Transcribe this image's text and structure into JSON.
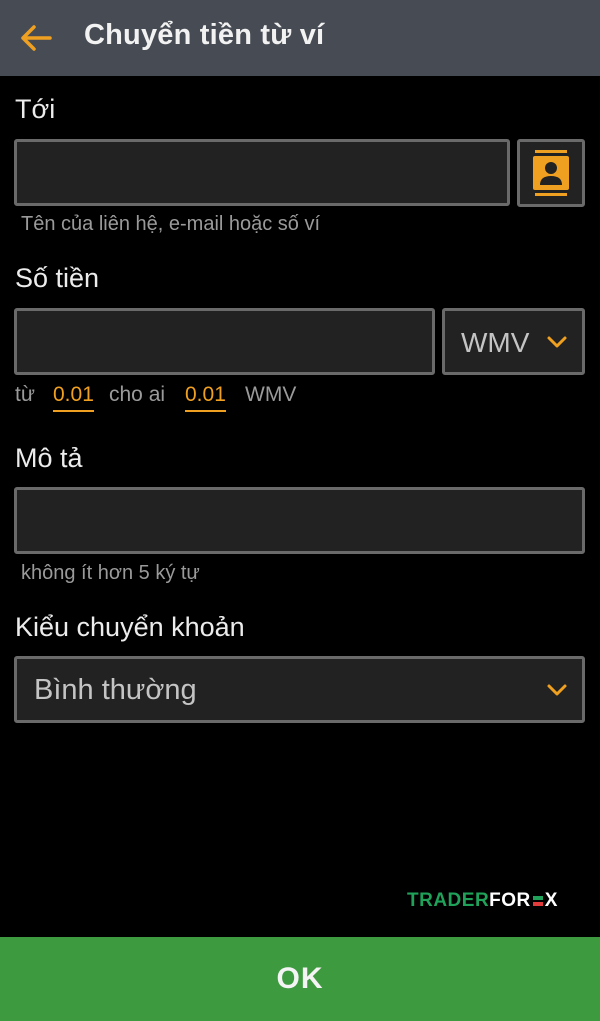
{
  "header": {
    "title": "Chuyển tiền từ ví",
    "back_icon": "arrow-left-icon"
  },
  "colors": {
    "accent": "#f0a020",
    "header_bg": "#474c54",
    "ok_bg": "#3e9a3f"
  },
  "to": {
    "label": "Tới",
    "value": "",
    "hint": "Tên của liên hệ, e-mail hoặc số ví",
    "contact_icon": "contact-book-icon"
  },
  "amount": {
    "label": "Số tiền",
    "value": "",
    "currency": "WMV",
    "range_from_label": "từ",
    "range_min": "0.01",
    "range_to_label": "cho ai",
    "range_max": "0.01",
    "range_unit": "WMV"
  },
  "description": {
    "label": "Mô tả",
    "value": "",
    "hint": "không ít hơn 5 ký tự"
  },
  "transfer_type": {
    "label": "Kiểu chuyển khoản",
    "selected": "Bình thường"
  },
  "watermark": {
    "part1": "TRADER",
    "part2": "FOR",
    "part3": "X"
  },
  "footer": {
    "ok_label": "OK"
  }
}
